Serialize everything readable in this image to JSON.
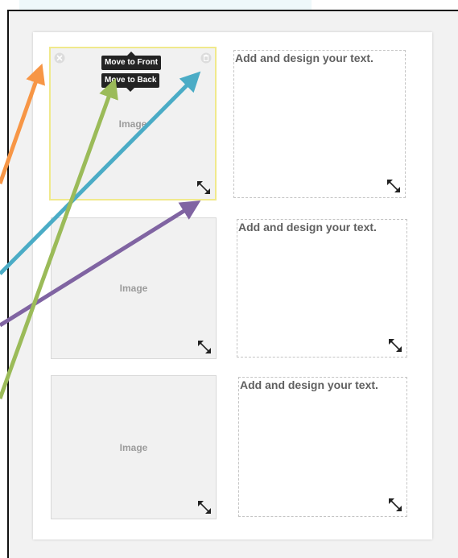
{
  "layout_rows": [
    {
      "image": {
        "label": "Image",
        "selected": true
      },
      "text": {
        "placeholder": "Add and design your text."
      }
    },
    {
      "image": {
        "label": "Image",
        "selected": false
      },
      "text": {
        "placeholder": "Add and design your text."
      }
    },
    {
      "image": {
        "label": "Image",
        "selected": false
      },
      "text": {
        "placeholder": "Add and design your text."
      }
    }
  ],
  "context_menu": {
    "move_front_label": "Move to Front",
    "move_back_label": "Move to Back"
  },
  "icons": {
    "remove": "close-circle-icon",
    "delete": "trash-icon",
    "resize": "resize-diagonal-icon"
  },
  "annotation_arrows": [
    {
      "color": "#f79646",
      "points_to": "close-circle-icon"
    },
    {
      "color": "#9bbb59",
      "points_to": "move-to-back-button"
    },
    {
      "color": "#4bacc6",
      "points_to": "trash-icon"
    },
    {
      "color": "#8064a2",
      "points_to": "resize-handle"
    }
  ],
  "colors": {
    "selection_border": "#f0e98c",
    "tooltip_bg": "#232323",
    "image_placeholder_bg": "#f1f1f1"
  }
}
